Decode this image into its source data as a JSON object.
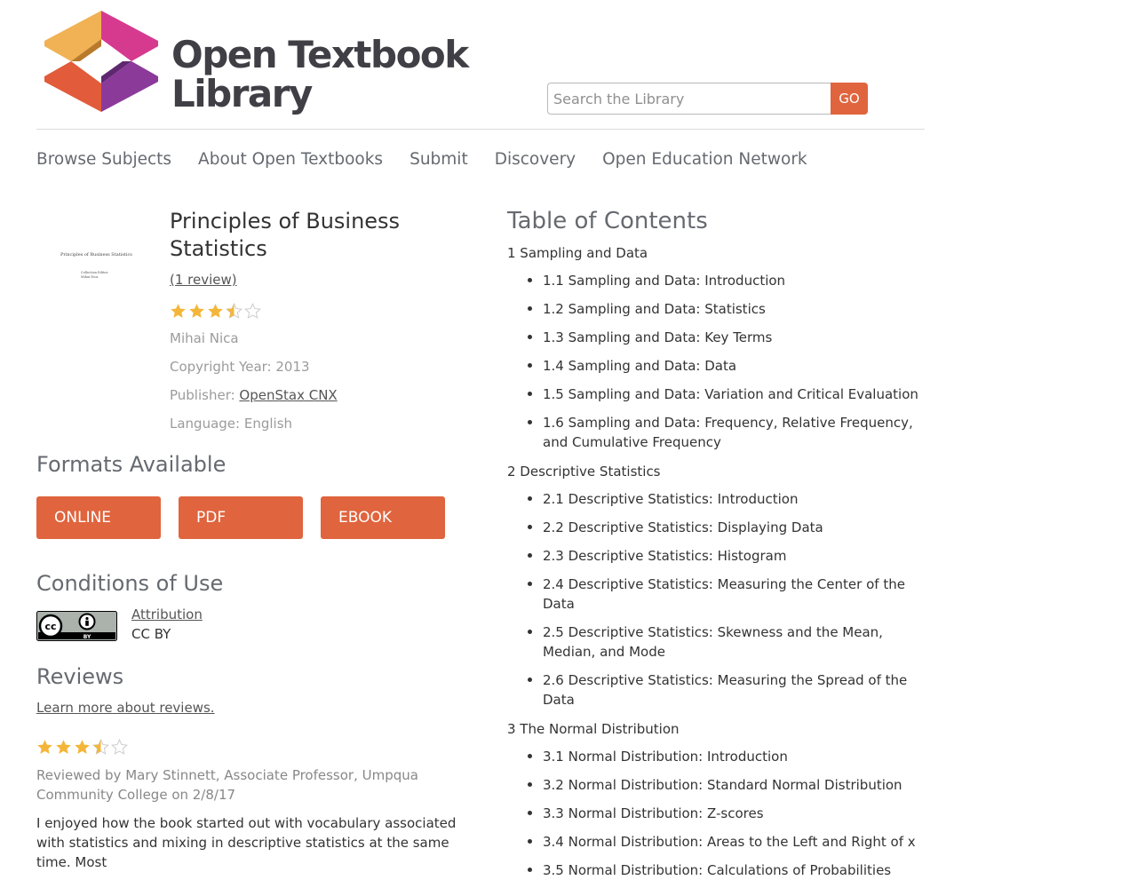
{
  "header": {
    "logo_line1": "Open Textbook",
    "logo_line2": "Library",
    "search_placeholder": "Search the Library",
    "go_label": "GO",
    "colors": {
      "accent": "#e0643d",
      "logo_orange": "#f0b254",
      "logo_pink": "#d63a8f",
      "logo_purple": "#8b3a9a",
      "logo_red": "#e25b3a"
    }
  },
  "nav": [
    "Browse Subjects",
    "About Open Textbooks",
    "Submit",
    "Discovery",
    "Open Education Network"
  ],
  "book": {
    "cover_title": "Principles of Business Statistics",
    "cover_author": "Collection Editor:",
    "cover_author2": "Mihai Nica",
    "title": "Principles of Business Statistics",
    "review_count": "(1 review)",
    "rating": 3.5,
    "author": "Mihai Nica",
    "copyright": "Copyright Year: 2013",
    "publisher_label": "Publisher: ",
    "publisher": "OpenStax CNX",
    "language": "Language: English"
  },
  "formats": {
    "heading": "Formats Available",
    "buttons": [
      "ONLINE",
      "PDF",
      "EBOOK"
    ]
  },
  "conditions": {
    "heading": "Conditions of Use",
    "license_link": "Attribution",
    "license_name": "CC BY",
    "badge_text": "BY"
  },
  "reviews": {
    "heading": "Reviews",
    "learn_more": "Learn more about reviews.",
    "rating": 3.5,
    "reviewer": "Reviewed by Mary Stinnett, Associate Professor, Umpqua Community College on 2/8/17",
    "body": "I enjoyed how the book started out with vocabulary associated with statistics and mixing in descriptive statistics at the same time. Most"
  },
  "toc": {
    "heading": "Table of Contents",
    "chapters": [
      {
        "title": "1 Sampling and Data",
        "items": [
          "1.1 Sampling and Data: Introduction",
          "1.2 Sampling and Data: Statistics",
          "1.3 Sampling and Data: Key Terms",
          "1.4 Sampling and Data: Data",
          "1.5 Sampling and Data: Variation and Critical Evaluation",
          "1.6 Sampling and Data: Frequency, Relative Frequency, and Cumulative Frequency"
        ]
      },
      {
        "title": "2 Descriptive Statistics",
        "items": [
          "2.1 Descriptive Statistics: Introduction",
          "2.2 Descriptive Statistics: Displaying Data",
          "2.3 Descriptive Statistics: Histogram",
          "2.4 Descriptive Statistics: Measuring the Center of the Data",
          "2.5 Descriptive Statistics: Skewness and the Mean, Median, and Mode",
          "2.6 Descriptive Statistics: Measuring the Spread of the Data"
        ]
      },
      {
        "title": "3 The Normal Distribution",
        "items": [
          "3.1 Normal Distribution: Introduction",
          "3.2 Normal Distribution: Standard Normal Distribution",
          "3.3 Normal Distribution: Z-scores",
          "3.4 Normal Distribution: Areas to the Left and Right of x",
          "3.5 Normal Distribution: Calculations of Probabilities"
        ]
      }
    ]
  }
}
